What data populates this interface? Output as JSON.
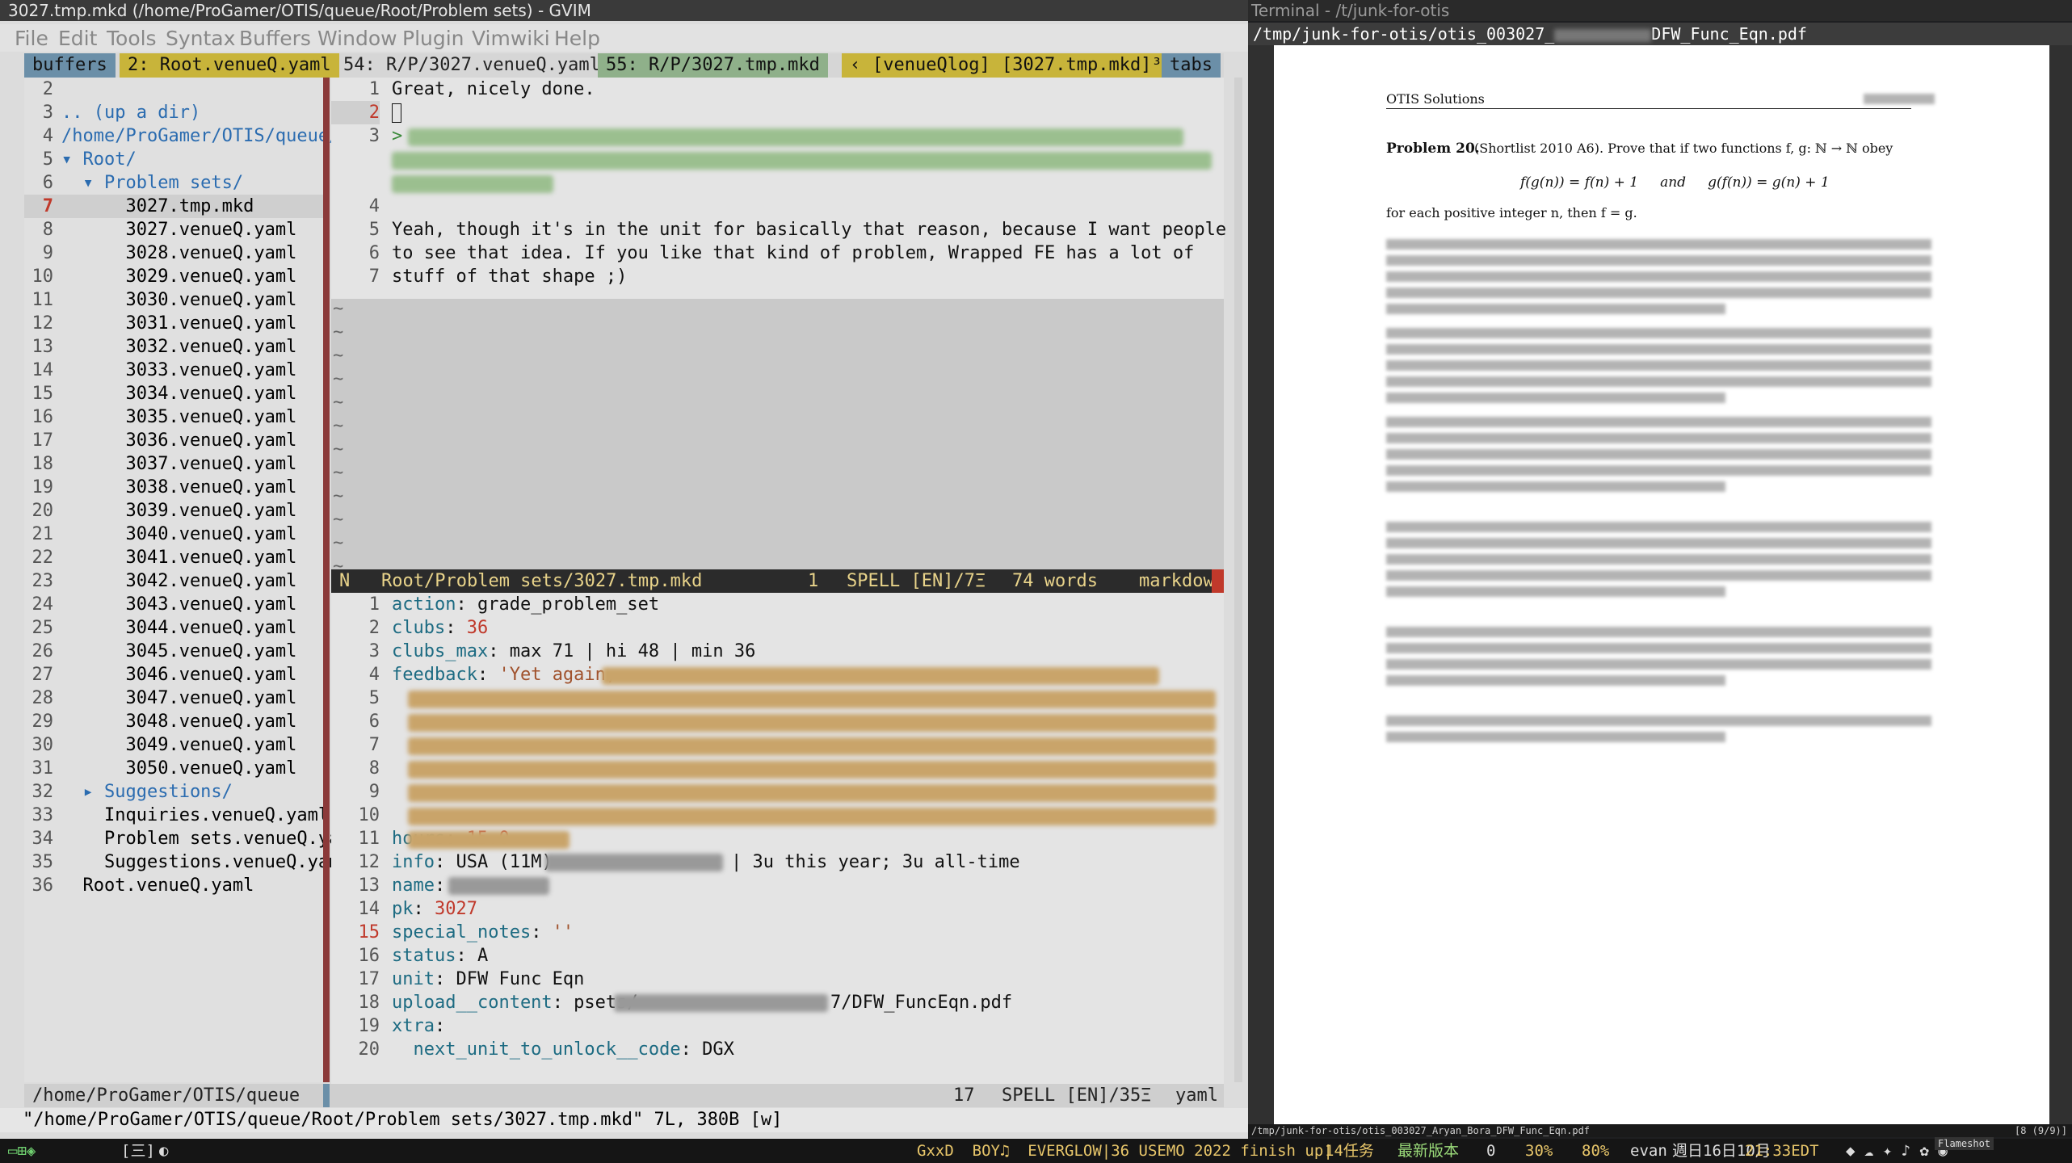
{
  "gvim": {
    "title": "3027.tmp.mkd (/home/ProGamer/OTIS/queue/Root/Problem sets) - GVIM",
    "menu": [
      "File",
      "Edit",
      "Tools",
      "Syntax",
      "Buffers",
      "Window",
      "Plugin",
      "Vimwiki",
      "Help"
    ],
    "tabline": {
      "buffers": "buffers",
      "tab1": "2: Root.venueQ.yaml",
      "tab2": "54: R/P/3027.venueQ.yaml",
      "tab3": "55: R/P/3027.tmp.mkd",
      "tab4": "[venueQlog]",
      "tab5": "[3027.tmp.mkd]³",
      "tabs": "tabs"
    },
    "tree": {
      "lines": [
        {
          "n": "2",
          "t": ""
        },
        {
          "n": "3",
          "t": ".. (up a dir)"
        },
        {
          "n": "4",
          "t": "/home/ProGamer/OTIS/queue/"
        },
        {
          "n": "5",
          "t": "▾ Root/"
        },
        {
          "n": "6",
          "t": "  ▾ Problem sets/"
        },
        {
          "n": "7",
          "t": "      3027.tmp.mkd"
        },
        {
          "n": "8",
          "t": "      3027.venueQ.yaml"
        },
        {
          "n": "9",
          "t": "      3028.venueQ.yaml"
        },
        {
          "n": "10",
          "t": "      3029.venueQ.yaml"
        },
        {
          "n": "11",
          "t": "      3030.venueQ.yaml"
        },
        {
          "n": "12",
          "t": "      3031.venueQ.yaml"
        },
        {
          "n": "13",
          "t": "      3032.venueQ.yaml"
        },
        {
          "n": "14",
          "t": "      3033.venueQ.yaml"
        },
        {
          "n": "15",
          "t": "      3034.venueQ.yaml"
        },
        {
          "n": "16",
          "t": "      3035.venueQ.yaml"
        },
        {
          "n": "17",
          "t": "      3036.venueQ.yaml"
        },
        {
          "n": "18",
          "t": "      3037.venueQ.yaml"
        },
        {
          "n": "19",
          "t": "      3038.venueQ.yaml"
        },
        {
          "n": "20",
          "t": "      3039.venueQ.yaml"
        },
        {
          "n": "21",
          "t": "      3040.venueQ.yaml"
        },
        {
          "n": "22",
          "t": "      3041.venueQ.yaml"
        },
        {
          "n": "23",
          "t": "      3042.venueQ.yaml"
        },
        {
          "n": "24",
          "t": "      3043.venueQ.yaml"
        },
        {
          "n": "25",
          "t": "      3044.venueQ.yaml"
        },
        {
          "n": "26",
          "t": "      3045.venueQ.yaml"
        },
        {
          "n": "27",
          "t": "      3046.venueQ.yaml"
        },
        {
          "n": "28",
          "t": "      3047.venueQ.yaml"
        },
        {
          "n": "29",
          "t": "      3048.venueQ.yaml"
        },
        {
          "n": "30",
          "t": "      3049.venueQ.yaml"
        },
        {
          "n": "31",
          "t": "      3050.venueQ.yaml"
        },
        {
          "n": "32",
          "t": "  ▸ Suggestions/"
        },
        {
          "n": "33",
          "t": "    Inquiries.venueQ.yaml"
        },
        {
          "n": "34",
          "t": "    Problem sets.venueQ.yam"
        },
        {
          "n": "35",
          "t": "    Suggestions.venueQ.yaml"
        },
        {
          "n": "36",
          "t": "  Root.venueQ.yaml"
        }
      ],
      "status": "/home/ProGamer/OTIS/queue"
    },
    "top_editor": {
      "lines": [
        {
          "n": "1",
          "t": "Great, nicely done."
        },
        {
          "n": "2",
          "t": ""
        },
        {
          "n": "3",
          "t": "> "
        },
        {
          "n": "4",
          "t": ""
        },
        {
          "n": "5",
          "t": "Yeah, though it's in the unit for basically that reason, because I want people"
        },
        {
          "n": "6",
          "t": "to see that idea. If you like that kind of problem, Wrapped FE has a lot of"
        },
        {
          "n": "7",
          "t": "stuff of that shape ;)"
        }
      ],
      "status": {
        "mode": "N",
        "file": "Root/Problem sets/3027.tmp.mkd",
        "col": "1",
        "spell": "SPELL [EN]/7Ξ",
        "words": "74 words",
        "ft": "markdown"
      }
    },
    "bottom_editor": {
      "lines": [
        {
          "n": "1",
          "k": "action",
          "v": " grade_problem_set"
        },
        {
          "n": "2",
          "k": "clubs",
          "v": " 36"
        },
        {
          "n": "3",
          "k": "clubs_max",
          "v": " max 71 | hi 48 | min 36"
        },
        {
          "n": "4",
          "k": "feedback",
          "v": " 'Yet again, "
        },
        {
          "n": "11",
          "k": "hours",
          "v": " 15.0"
        },
        {
          "n": "12",
          "k": "info",
          "v": " USA (11M) "
        },
        {
          "n": "13",
          "k": "name",
          "v": " "
        },
        {
          "n": "14",
          "k": "pk",
          "v": " 3027"
        },
        {
          "n": "15",
          "k": "special_notes",
          "v": " ''"
        },
        {
          "n": "16",
          "k": "status",
          "v": " A"
        },
        {
          "n": "17",
          "k": "unit",
          "v": " DFW Func Eqn"
        },
        {
          "n": "18",
          "k": "upload__content",
          "v": " psets/"
        },
        {
          "n": "19",
          "k": "xtra",
          "v": ""
        },
        {
          "n": "20",
          "k": "  next_unit_to_unlock__code",
          "v": " DGX"
        }
      ],
      "info_tail": "| 3u this year; 3u all-time",
      "upload_tail": "7/DFW_FuncEqn.pdf",
      "status": {
        "col": "17",
        "spell": "SPELL [EN]/35Ξ",
        "ft": "yaml"
      }
    },
    "cmdline": "\"/home/ProGamer/OTIS/queue/Root/Problem sets/3027.tmp.mkd\" 7L, 380B [w]"
  },
  "pdf": {
    "window_title": "Terminal - /t/junk-for-otis",
    "path_prefix": "/tmp/junk-for-otis/otis_003027_",
    "path_suffix": "DFW_Func_Eqn.pdf",
    "header_left": "OTIS Solutions",
    "problem_label": "Problem 20.",
    "problem_text": "(Shortlist 2010 A6). Prove that if two functions f, g: ℕ → ℕ obey",
    "equation": "f(g(n)) = f(n) + 1     and     g(f(n)) = g(n) + 1",
    "conclusion": "for each positive integer n, then f = g.",
    "footer_path": "/tmp/junk-for-otis/otis_003027_Aryan_Bora_DFW_Func_Eqn.pdf",
    "footer_page": "[8 (9/9)]"
  },
  "taskbar": {
    "left_items": [
      "[三]"
    ],
    "status": "GxxD  BOY♫  EVERGLOW|36 USEMO 2022 finish up|",
    "tasks": "14任务",
    "version": "最新版本",
    "vol": "0",
    "battery1": "30%",
    "battery2": "80%",
    "user": "evan",
    "date": "週日16日10月",
    "time": "21:33EDT",
    "tooltip": "Flameshot"
  }
}
